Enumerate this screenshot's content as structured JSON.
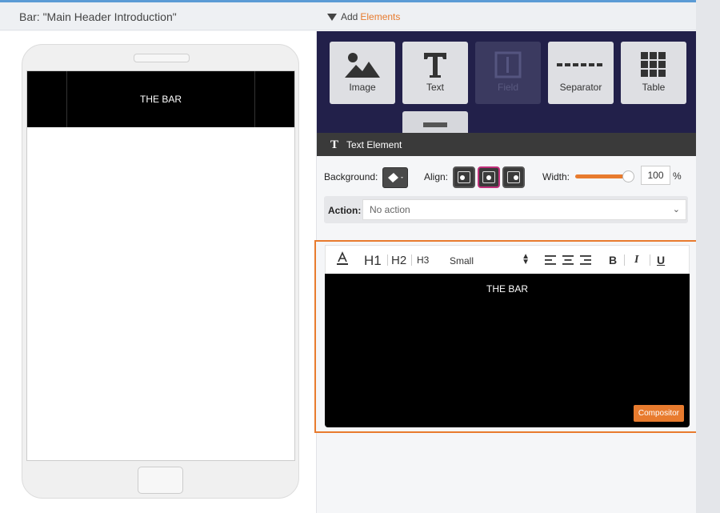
{
  "left_header": {
    "title": "Bar: \"Main Header Introduction\""
  },
  "right_header": {
    "add_label": "Add",
    "add_accent": "Elements"
  },
  "preview": {
    "bar_text": "THE BAR"
  },
  "palette": {
    "tiles": [
      {
        "label": "Image",
        "icon": "image-icon"
      },
      {
        "label": "Text",
        "icon": "text-icon"
      },
      {
        "label": "Field",
        "icon": "field-icon",
        "disabled": true
      },
      {
        "label": "Separator",
        "icon": "separator-icon"
      },
      {
        "label": "Table",
        "icon": "table-icon"
      }
    ]
  },
  "element_panel": {
    "header_label": "Text Element",
    "background_label": "Background:",
    "align_label": "Align:",
    "align_selected": "center",
    "width_label": "Width:",
    "width_value": "100",
    "width_unit": "%",
    "action_label": "Action:",
    "action_value": "No action"
  },
  "editor": {
    "toolbar": {
      "h1": "H1",
      "h2": "H2",
      "h3": "H3",
      "size_value": "Small",
      "bold": "B",
      "italic": "I",
      "underline": "U"
    },
    "content_text": "THE BAR",
    "compositor_label": "Compositor"
  },
  "colors": {
    "accent": "#e87b2e",
    "palette_bg": "#22204a",
    "align_active": "#c0307a"
  }
}
